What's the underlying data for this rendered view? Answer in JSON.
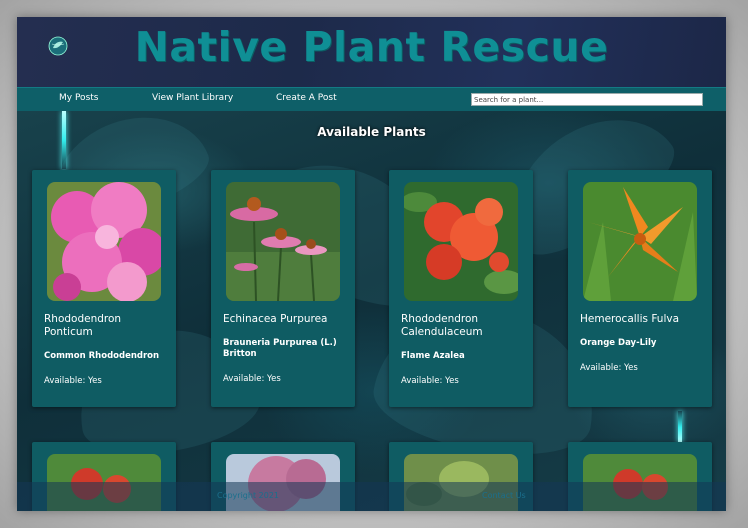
{
  "site": {
    "title": "Native Plant Rescue",
    "logo_icon": "globe-leaf-icon"
  },
  "nav": {
    "links": [
      "My Posts",
      "View Plant Library",
      "Create A Post"
    ],
    "search_placeholder": "Search for a plant..."
  },
  "main": {
    "section_title": "Available Plants",
    "cards": [
      {
        "title": "Rhododendron Ponticum",
        "common": "Common Rhododendron",
        "available": "Available: Yes",
        "image_icon": "pink-rhododendron-photo"
      },
      {
        "title": "Echinacea Purpurea",
        "common": "Brauneria Purpurea (L.) Britton",
        "available": "Available: Yes",
        "image_icon": "coneflower-photo"
      },
      {
        "title": "Rhododendron Calendulaceum",
        "common": "Flame Azalea",
        "available": "Available: Yes",
        "image_icon": "flame-azalea-photo"
      },
      {
        "title": "Hemerocallis Fulva",
        "common": "Orange Day-Lily",
        "available": "Available: Yes",
        "image_icon": "orange-daylily-photo"
      }
    ],
    "row2_images": [
      "red-flower-photo",
      "redbud-tree-photo",
      "green-foliage-photo",
      "red-flower-photo"
    ]
  },
  "footer": {
    "copyright": "Copyright 2021",
    "contact": "Contact Us"
  },
  "colors": {
    "teal": "#0f5c63",
    "title": "#0f8f95",
    "header": "#242e50"
  }
}
